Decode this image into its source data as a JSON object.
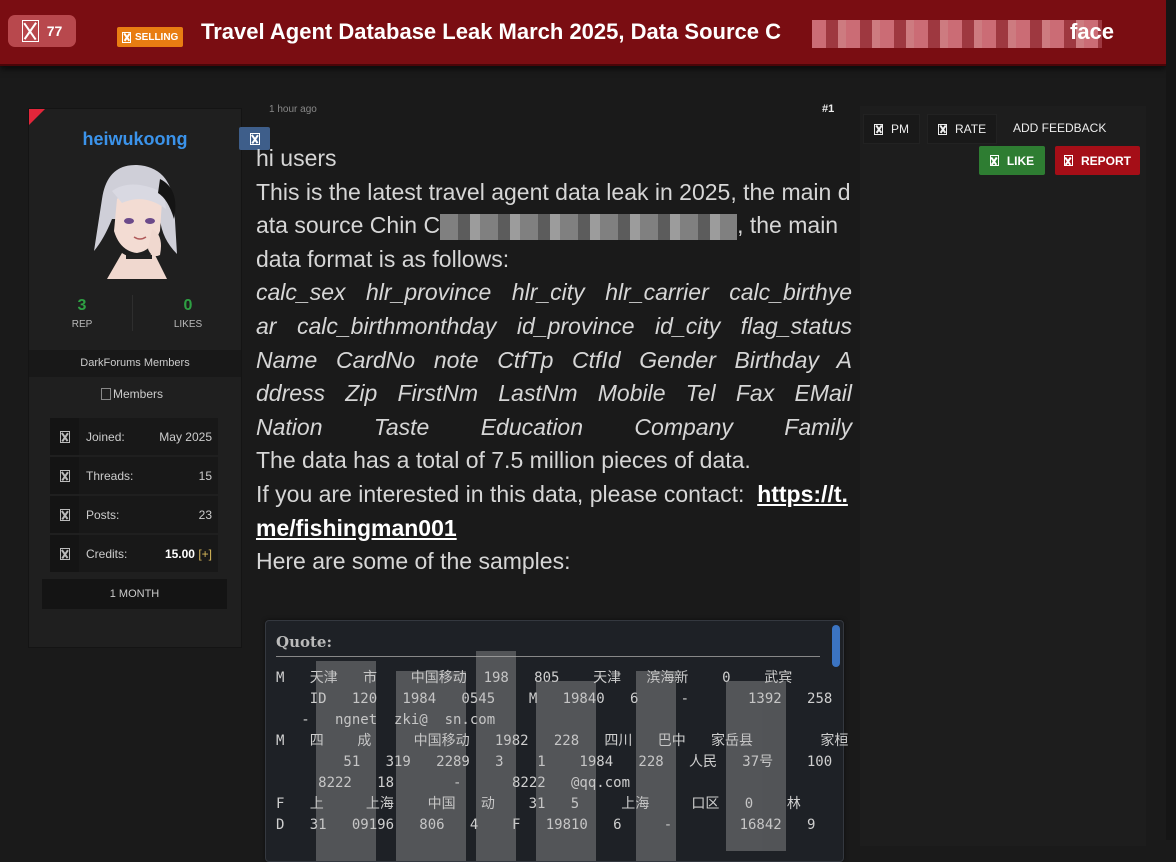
{
  "header": {
    "views": "77",
    "prefix": "SELLING",
    "title": "Travel Agent Database Leak March 2025, Data Source C",
    "title_tail": "face"
  },
  "user": {
    "username": "heiwukoong",
    "rep_value": "3",
    "rep_label": "REP",
    "likes_value": "0",
    "likes_label": "LIKES",
    "group": "DarkForums Members",
    "group_image_alt": "Members",
    "info": [
      {
        "key": "Joined:",
        "value": "May 2025"
      },
      {
        "key": "Threads:",
        "value": "15"
      },
      {
        "key": "Posts:",
        "value": "23"
      },
      {
        "key": "Credits:",
        "value": "15.00",
        "extra": "[+]"
      }
    ],
    "badge": "1 MONTH"
  },
  "post": {
    "time": "1 hour ago",
    "number": "#1",
    "greeting": "hi users",
    "intro_before": "This is the latest travel agent data leak in 2025, the main data source Chin C",
    "intro_after": ", the main data format is as follows:",
    "fields_line1": "calc_sex  hlr_province  hlr_city  hlr_carrier  calc_birthyear  calc_birthmonthday  id_province  id_city  flag_status  Name  CardNo  note  CtfTp  CtfId  Gender  Birthday  Address  Zip  FirstNm  LastNm  Mobile  Tel  Fax  EMail  Nation  Taste  Education  Company  Family",
    "total": "The data has a total of 7.5 million pieces of data.",
    "contact_text": "If you are interested in this data, please contact:",
    "contact_link": "https://t.me/fishingman001",
    "samples_text": "Here are some of the samples:",
    "quote_label": "Quote:",
    "quote_lines": "M   天津   市    中国移动  198   805    天津   滨海新    0    武宾\n    ID   120   1984   0545    M   19840   6     -       1392   258     -\n   -   ngnet  zki@  sn.com\nM   四    成     中国移动   1982   228   四川   巴中   家岳县        家桓\n        51   319   2289   3    1    1984   228   人民   37号    100\n     8222   18       -      8222   @qq.com\nF   上     上海    中国   动    31   5     上海     口区   0    林         I\nD   31   09196   806   4    F   19810   6     -        16842   9      -"
  },
  "actions": {
    "pm": "PM",
    "rate": "RATE",
    "add_feedback": "ADD FEEDBACK",
    "like": "LIKE",
    "report": "REPORT"
  }
}
